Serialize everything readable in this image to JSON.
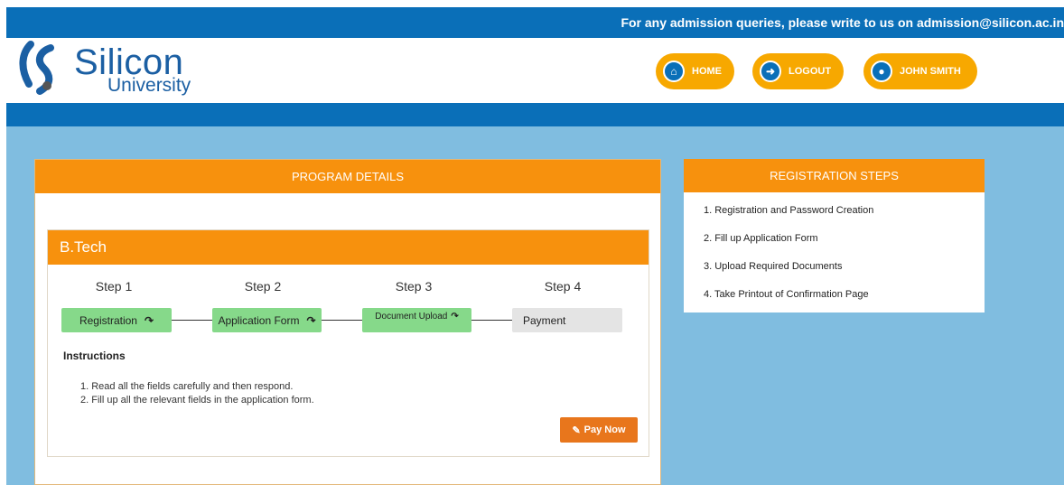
{
  "topbar": {
    "text": "For any admission queries, please write to us on admission@silicon.ac.in"
  },
  "logo": {
    "line1": "Silicon",
    "line2": "University"
  },
  "nav": [
    {
      "label": "HOME",
      "icon": "home-icon"
    },
    {
      "label": "LOGOUT",
      "icon": "logout-icon"
    },
    {
      "label": "JOHN SMITH",
      "icon": "user-icon"
    }
  ],
  "program": {
    "header": "PROGRAM DETAILS",
    "course": "B.Tech",
    "steps": [
      {
        "label": "Step 1",
        "box": "Registration",
        "done": true
      },
      {
        "label": "Step 2",
        "box": "Application Form",
        "done": true
      },
      {
        "label": "Step 3",
        "box": "Document Upload",
        "done": true
      },
      {
        "label": "Step 4",
        "box": "Payment",
        "done": false
      }
    ],
    "instructions_title": "Instructions",
    "instructions": [
      "1. Read all the fields carefully and then respond.",
      "2. Fill up all the relevant fields in the application form."
    ],
    "pay_button": "Pay Now"
  },
  "registration": {
    "header": "REGISTRATION STEPS",
    "items": [
      "1. Registration and Password Creation",
      "2. Fill up Application Form",
      "3. Upload Required Documents",
      "4. Take Printout of Confirmation Page"
    ]
  },
  "colors": {
    "blue": "#0a6fb8",
    "orange": "#f7910d",
    "green": "#86d98a",
    "bg": "#80bde0"
  }
}
